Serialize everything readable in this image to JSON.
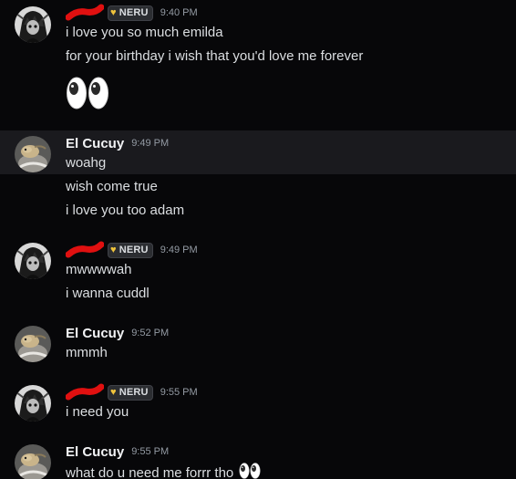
{
  "messages": [
    {
      "username": "",
      "badge": "NERU",
      "badge_icon": "yellow-heart",
      "time": "9:40 PM",
      "lines": [
        "i love you so much emilda",
        "for your birthday i wish that you'd love me forever"
      ],
      "emoji": "eyes"
    },
    {
      "username": "El Cucuy",
      "time": "9:49 PM",
      "lines": [
        "woahg",
        "wish come true",
        "i love you too adam"
      ]
    },
    {
      "username": "",
      "badge": "NERU",
      "badge_icon": "yellow-heart",
      "time": "9:49 PM",
      "lines": [
        "mwwwwah",
        "i wanna cuddl"
      ]
    },
    {
      "username": "El Cucuy",
      "time": "9:52 PM",
      "lines": [
        "mmmh"
      ]
    },
    {
      "username": "",
      "badge": "NERU",
      "badge_icon": "yellow-heart",
      "time": "9:55 PM",
      "lines": [
        "i need you"
      ]
    },
    {
      "username": "El Cucuy",
      "time": "9:55 PM",
      "lines": [
        "what do u need me forrr tho"
      ],
      "inline_emoji": "eyes"
    }
  ],
  "colors": {
    "background": "#070709",
    "hover_row": "#1a1a1e",
    "text": "#dbdee1",
    "timestamp": "#949ba4",
    "redaction": "#e01010",
    "badge_heart": "#f0c43c"
  }
}
